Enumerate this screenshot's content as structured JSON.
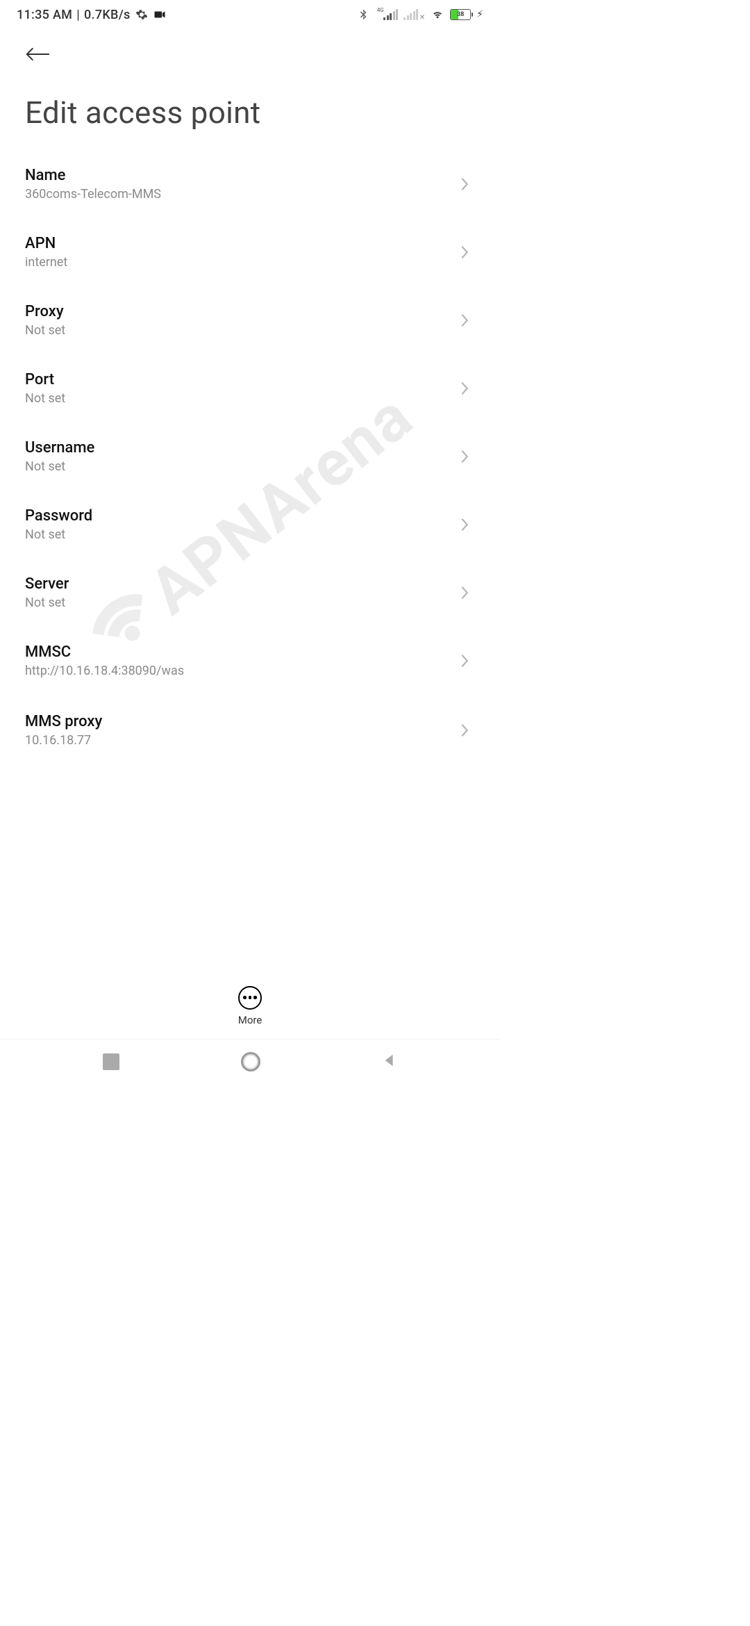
{
  "status_bar": {
    "time": "11:35 AM",
    "net_speed": "0.7KB/s",
    "signal_label": "4G",
    "battery_pct": "38"
  },
  "header": {
    "title": "Edit access point"
  },
  "watermark": {
    "text": "APNArena"
  },
  "settings": [
    {
      "label": "Name",
      "value": "360coms-Telecom-MMS"
    },
    {
      "label": "APN",
      "value": "internet"
    },
    {
      "label": "Proxy",
      "value": "Not set"
    },
    {
      "label": "Port",
      "value": "Not set"
    },
    {
      "label": "Username",
      "value": "Not set"
    },
    {
      "label": "Password",
      "value": "Not set"
    },
    {
      "label": "Server",
      "value": "Not set"
    },
    {
      "label": "MMSC",
      "value": "http://10.16.18.4:38090/was"
    },
    {
      "label": "MMS proxy",
      "value": "10.16.18.77"
    }
  ],
  "bottom_bar": {
    "more_label": "More"
  }
}
